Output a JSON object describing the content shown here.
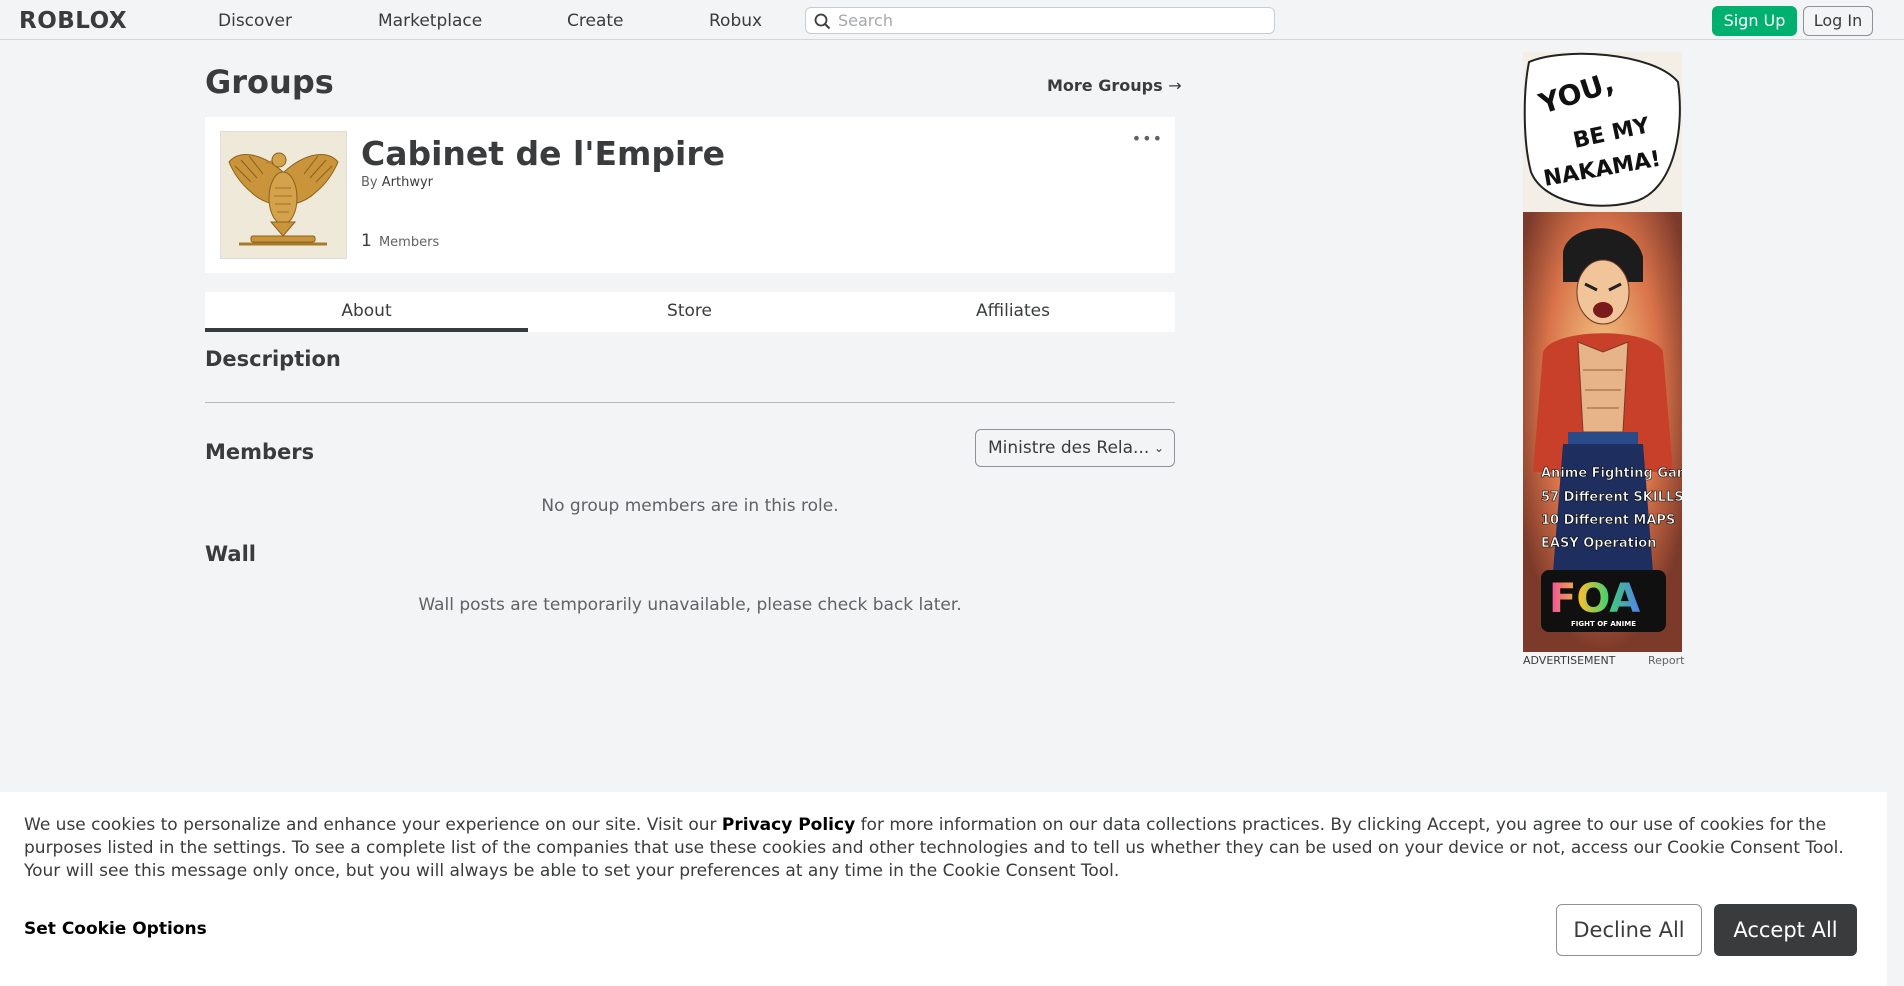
{
  "brand": {
    "logo_text": "ROBLOX",
    "accent": "#00b06f",
    "dark": "#393b3d"
  },
  "nav": {
    "links": [
      "Discover",
      "Marketplace",
      "Create",
      "Robux"
    ],
    "search_placeholder": "Search",
    "signup_label": "Sign Up",
    "login_label": "Log In"
  },
  "page": {
    "title": "Groups",
    "more_groups_label": "More Groups",
    "more_groups_arrow": "→"
  },
  "group": {
    "name": "Cabinet de l'Empire",
    "by_prefix": "By",
    "owner": "Arthwyr",
    "member_count": "1",
    "members_label": "Members",
    "more_menu": "•••"
  },
  "tabs": [
    {
      "label": "About",
      "active": true
    },
    {
      "label": "Store",
      "active": false
    },
    {
      "label": "Affiliates",
      "active": false
    }
  ],
  "sections": {
    "description_title": "Description",
    "members_title": "Members",
    "role_selected": "Ministre des Rela...",
    "members_empty": "No group members are in this role.",
    "wall_title": "Wall",
    "wall_empty": "Wall posts are temporarily unavailable, please check back later."
  },
  "ad": {
    "speech_line_1": "YOU,",
    "speech_line_2": "BE MY",
    "speech_line_3": "NAKAMA!",
    "features": [
      "Anime Fighting Game",
      "57 Different SKILLS",
      "10 Different MAPS",
      "EASY Operation"
    ],
    "brand": "FOA",
    "brand_sub": "FIGHT OF ANIME",
    "label": "ADVERTISEMENT",
    "report": "Report"
  },
  "cookie": {
    "text_before": "We use cookies to personalize and enhance your experience on our site. Visit our ",
    "privacy_link": "Privacy Policy",
    "text_after": " for more information on our data collections practices. By clicking Accept, you agree to our use of cookies for the purposes listed in the settings. To see a complete list of the companies that use these cookies and other technologies and to tell us whether they can be used on your device or not, access our Cookie Consent Tool. Your will see this message only once, but you will always be able to set your preferences at any time in the Cookie Consent Tool.",
    "options_label": "Set Cookie Options",
    "decline_label": "Decline All",
    "accept_label": "Accept All"
  }
}
